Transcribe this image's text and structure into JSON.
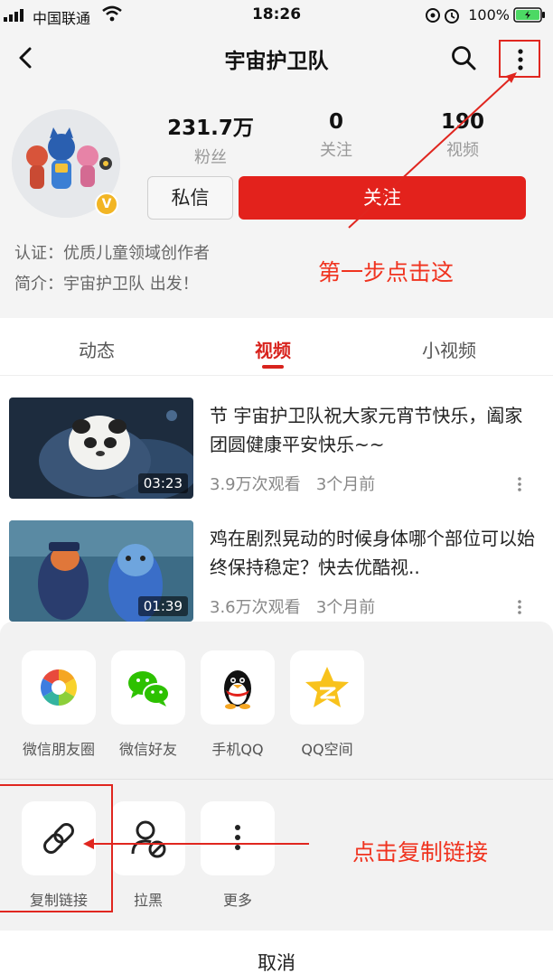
{
  "status_bar": {
    "carrier": "中国联通",
    "time": "18:26",
    "battery": "100%"
  },
  "navbar": {
    "title": "宇宙护卫队",
    "back_icon": "chevron-left-icon",
    "search_icon": "search-icon",
    "more_icon": "more-vertical-icon"
  },
  "profile": {
    "badge": "V",
    "stats": [
      {
        "value": "231.7万",
        "label": "粉丝"
      },
      {
        "value": "0",
        "label": "关注"
      },
      {
        "value": "190",
        "label": "视频"
      }
    ],
    "message_label": "私信",
    "follow_label": "关注",
    "certification": "认证：优质儿童领域创作者",
    "intro": "简介：宇宙护卫队 出发！"
  },
  "annotations": {
    "step1": "第一步点击这",
    "step2": "点击复制链接"
  },
  "tabs": [
    {
      "label": "动态"
    },
    {
      "label": "视频"
    },
    {
      "label": "小视频"
    }
  ],
  "videos": [
    {
      "title": "节  宇宙护卫队祝大家元宵节快乐，阖家团圆健康平安快乐~~",
      "duration": "03:23",
      "views": "3.9万次观看",
      "time": "3个月前"
    },
    {
      "title": "鸡在剧烈晃动的时候身体哪个部位可以始终保持稳定？快去优酷视..",
      "duration": "01:39",
      "views": "3.6万次观看",
      "time": "3个月前"
    }
  ],
  "share_sheet": {
    "row1": [
      {
        "label": "微信朋友圈",
        "icon": "wechat-moments-icon"
      },
      {
        "label": "微信好友",
        "icon": "wechat-icon"
      },
      {
        "label": "手机QQ",
        "icon": "qq-icon"
      },
      {
        "label": "QQ空间",
        "icon": "qzone-icon"
      }
    ],
    "row2": [
      {
        "label": "复制链接",
        "icon": "link-icon"
      },
      {
        "label": "拉黑",
        "icon": "block-user-icon"
      },
      {
        "label": "更多",
        "icon": "more-vertical-icon"
      }
    ],
    "cancel_label": "取消"
  },
  "colors": {
    "accent": "#e3221c",
    "annotation": "#f0331f"
  }
}
